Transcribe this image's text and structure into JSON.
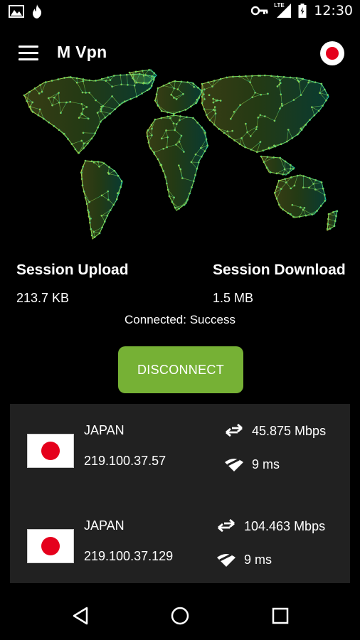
{
  "status_bar": {
    "time": "12:30",
    "network": "LTE",
    "icons": [
      "gallery-icon",
      "flame-icon",
      "vpn-key-icon",
      "signal-icon",
      "battery-icon"
    ]
  },
  "toolbar": {
    "title": "M Vpn",
    "menu_icon": "menu-icon",
    "flag_icon": "japan-flag-icon"
  },
  "stats": {
    "upload_label": "Session Upload",
    "upload_value": "213.7 KB",
    "download_label": "Session Download",
    "download_value": "1.5 MB",
    "status": "Connected: Success"
  },
  "disconnect_label": "DISCONNECT",
  "colors": {
    "accent_green": "#76b135",
    "map_gradient_start": "#c8d84a",
    "map_gradient_end": "#1fd3b0",
    "list_background": "#212121"
  },
  "servers": [
    {
      "country": "JAPAN",
      "ip": "219.100.37.57",
      "speed": "45.875 Mbps",
      "ping": "9 ms"
    },
    {
      "country": "JAPAN",
      "ip": "219.100.37.129",
      "speed": "104.463 Mbps",
      "ping": "9 ms"
    }
  ],
  "nav": {
    "icons": [
      "back-icon",
      "home-icon",
      "recents-icon"
    ]
  }
}
